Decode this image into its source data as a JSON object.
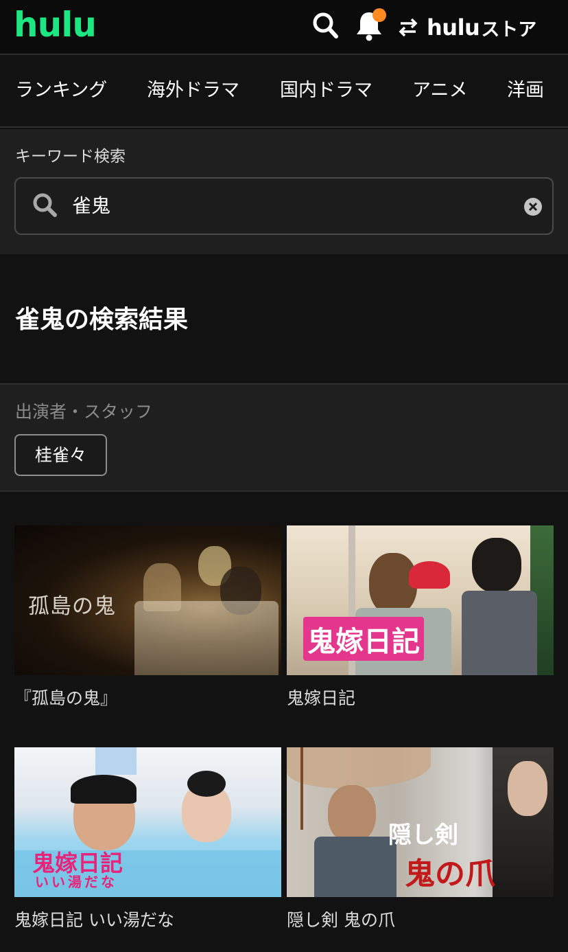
{
  "header": {
    "logo": "hulu",
    "store_label": "hulu",
    "store_suffix": "ストア",
    "icons": [
      "search-icon",
      "bell-icon",
      "swap-icon"
    ],
    "accent_color": "#1ce783",
    "notification_dot_color": "#ff8a1f"
  },
  "nav": {
    "items": [
      "ランキング",
      "海外ドラマ",
      "国内ドラマ",
      "アニメ",
      "洋画"
    ]
  },
  "search": {
    "label": "キーワード検索",
    "value": "雀鬼"
  },
  "results": {
    "title": "雀鬼の検索結果"
  },
  "cast": {
    "label": "出演者・スタッフ",
    "chips": [
      "桂雀々"
    ]
  },
  "titles": [
    {
      "name": "『孤島の鬼』",
      "thumb_text": "孤島の鬼"
    },
    {
      "name": "鬼嫁日記",
      "thumb_text": "鬼嫁日記"
    },
    {
      "name": "鬼嫁日記 いい湯だな",
      "thumb_text": "鬼嫁日記",
      "thumb_subtext": "いい湯だな"
    },
    {
      "name": "隠し剣 鬼の爪",
      "thumb_text": "隠し剣",
      "thumb_subtext": "鬼の爪"
    }
  ]
}
